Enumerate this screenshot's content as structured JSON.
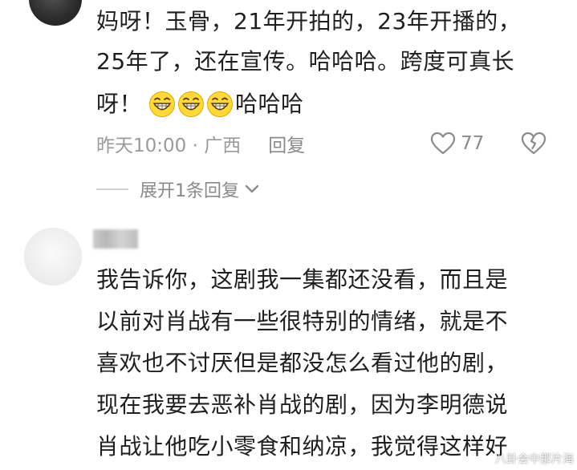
{
  "comment1": {
    "line1": "妈呀！玉骨，21年开拍的，23年开播的，",
    "line2": "25年了，还在宣传。哈哈哈。跨度可真长",
    "line3_prefix": "呀！",
    "line3_suffix": "哈哈哈",
    "emoji_icons": [
      "grin-emoji-icon",
      "grin-emoji-icon",
      "grin-emoji-icon"
    ],
    "timestamp": "昨天10:00 · 广西",
    "reply_label": "回复",
    "like_count": "77",
    "expand_label": "展开1条回复"
  },
  "comment2": {
    "lines": [
      "我告诉你，这剧我一集都还没看，而且是",
      "以前对肖战有一些很特别的情绪，就是不",
      "喜欢也不讨厌但是都没怎么看过他的剧，",
      "现在我要去恶补肖战的剧，因为李明德说",
      "肖战让他吃小零食和纳凉，我觉得这样好"
    ]
  },
  "watermark": "八卦会中那片海",
  "colors": {
    "text_primary": "#1f1f1f",
    "text_secondary": "#9a9a9a",
    "emoji_yellow": "#ffd93b"
  }
}
